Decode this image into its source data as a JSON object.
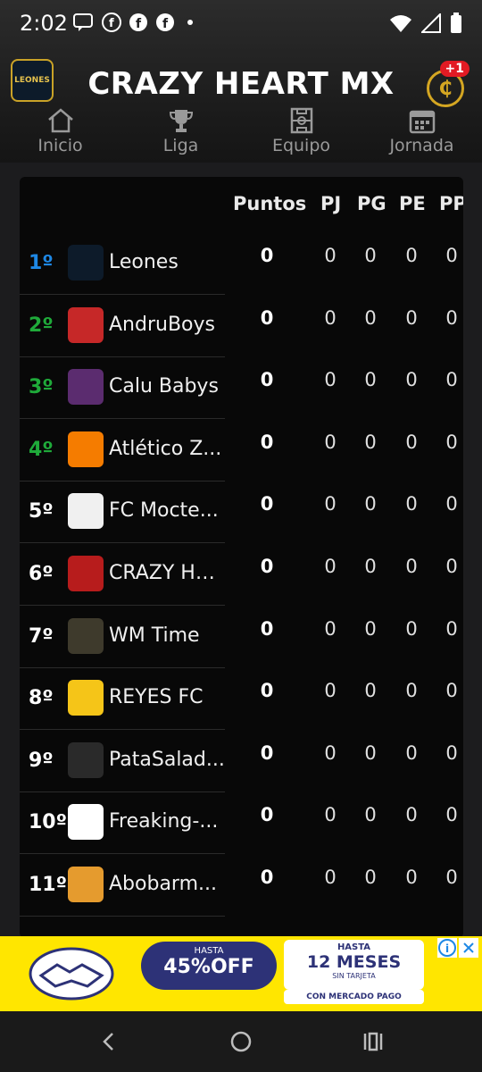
{
  "status": {
    "time": "2:02"
  },
  "header": {
    "logo_text": "LEONES",
    "title": "CRAZY HEART MX",
    "coin_symbol": "₵",
    "coin_badge": "+1"
  },
  "tabs": [
    {
      "label": "Inicio",
      "icon": "home-icon"
    },
    {
      "label": "Liga",
      "icon": "trophy-icon"
    },
    {
      "label": "Equipo",
      "icon": "field-icon"
    },
    {
      "label": "Jornada",
      "icon": "calendar-icon"
    }
  ],
  "table": {
    "columns": [
      "Puntos",
      "PJ",
      "PG",
      "PE",
      "PP"
    ],
    "rows": [
      {
        "rank": "1º",
        "team": "Leones",
        "puntos": "0",
        "pj": "0",
        "pg": "0",
        "pe": "0",
        "pp": "0",
        "rank_color": "#1e88e5",
        "avatar_color": "#0d1b2a"
      },
      {
        "rank": "2º",
        "team": "AndruBoys",
        "puntos": "0",
        "pj": "0",
        "pg": "0",
        "pe": "0",
        "pp": "0",
        "rank_color": "#1faa3a",
        "avatar_color": "#c62828"
      },
      {
        "rank": "3º",
        "team": "Calu Babys",
        "puntos": "0",
        "pj": "0",
        "pg": "0",
        "pe": "0",
        "pp": "0",
        "rank_color": "#1faa3a",
        "avatar_color": "#5b2c6f"
      },
      {
        "rank": "4º",
        "team": "Atlético Z...",
        "puntos": "0",
        "pj": "0",
        "pg": "0",
        "pe": "0",
        "pp": "0",
        "rank_color": "#1faa3a",
        "avatar_color": "#f57c00"
      },
      {
        "rank": "5º",
        "team": "FC Mocte...",
        "puntos": "0",
        "pj": "0",
        "pg": "0",
        "pe": "0",
        "pp": "0",
        "rank_color": "#ffffff",
        "avatar_color": "#f0f0f0"
      },
      {
        "rank": "6º",
        "team": "CRAZY HE...",
        "puntos": "0",
        "pj": "0",
        "pg": "0",
        "pe": "0",
        "pp": "0",
        "rank_color": "#ffffff",
        "avatar_color": "#b71c1c"
      },
      {
        "rank": "7º",
        "team": "WM Time",
        "puntos": "0",
        "pj": "0",
        "pg": "0",
        "pe": "0",
        "pp": "0",
        "rank_color": "#ffffff",
        "avatar_color": "#3e3a2c"
      },
      {
        "rank": "8º",
        "team": "REYES FC",
        "puntos": "0",
        "pj": "0",
        "pg": "0",
        "pe": "0",
        "pp": "0",
        "rank_color": "#ffffff",
        "avatar_color": "#f5c518"
      },
      {
        "rank": "9º",
        "team": "PataSalad...",
        "puntos": "0",
        "pj": "0",
        "pg": "0",
        "pe": "0",
        "pp": "0",
        "rank_color": "#ffffff",
        "avatar_color": "#2a2a2a"
      },
      {
        "rank": "10º",
        "team": "Freaking-...",
        "puntos": "0",
        "pj": "0",
        "pg": "0",
        "pe": "0",
        "pp": "0",
        "rank_color": "#ffffff",
        "avatar_color": "#ffffff"
      },
      {
        "rank": "11º",
        "team": "Abobarm...",
        "puntos": "0",
        "pj": "0",
        "pg": "0",
        "pe": "0",
        "pp": "0",
        "rank_color": "#ffffff",
        "avatar_color": "#e59b2e"
      }
    ]
  },
  "ad": {
    "badge1_top": "HASTA",
    "badge1_main": "45%OFF",
    "badge2_top": "HASTA",
    "badge2_main": "12 MESES",
    "badge2_sub": "SIN TARJETA",
    "footer": "CON MERCADO PAGO"
  },
  "colors": {
    "accent_gold": "#d4a622",
    "badge_red": "#e21b24",
    "ad_yellow": "#ffe600"
  }
}
